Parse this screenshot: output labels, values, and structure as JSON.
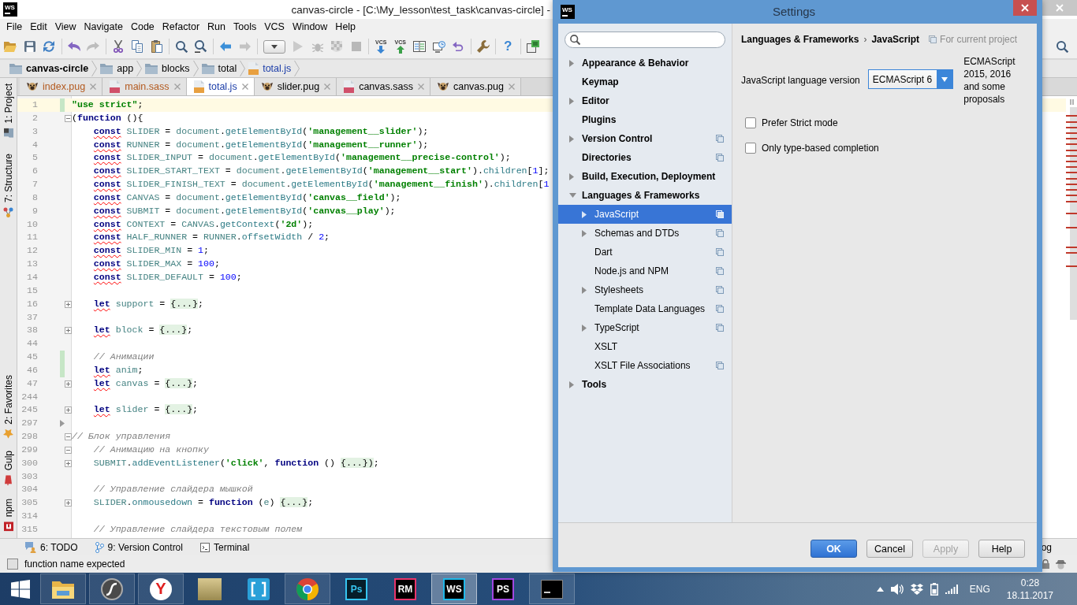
{
  "ide": {
    "logo": "WS",
    "title": "canvas-circle - [C:\\My_lesson\\test_task\\canvas-circle] -",
    "menu": [
      {
        "label": "File"
      },
      {
        "label": "Edit"
      },
      {
        "label": "View"
      },
      {
        "label": "Navigate"
      },
      {
        "label": "Code"
      },
      {
        "label": "Refactor"
      },
      {
        "label": "Run"
      },
      {
        "label": "Tools"
      },
      {
        "label": "VCS"
      },
      {
        "label": "Window"
      },
      {
        "label": "Help"
      }
    ],
    "toolbar": [
      {
        "kind": "open",
        "disabled": false
      },
      {
        "kind": "save",
        "disabled": false
      },
      {
        "kind": "sync",
        "disabled": false
      },
      {
        "kind": "separator"
      },
      {
        "kind": "undo",
        "disabled": false
      },
      {
        "kind": "redo",
        "disabled": true
      },
      {
        "kind": "separator"
      },
      {
        "kind": "cut",
        "disabled": false
      },
      {
        "kind": "copy",
        "disabled": false
      },
      {
        "kind": "paste",
        "disabled": false
      },
      {
        "kind": "separator"
      },
      {
        "kind": "find",
        "disabled": false
      },
      {
        "kind": "replace",
        "disabled": false
      },
      {
        "kind": "separator"
      },
      {
        "kind": "back",
        "disabled": false
      },
      {
        "kind": "forward",
        "disabled": true
      },
      {
        "kind": "separator"
      },
      {
        "kind": "run_config",
        "disabled": false
      },
      {
        "kind": "run",
        "disabled": true
      },
      {
        "kind": "debug",
        "disabled": true
      },
      {
        "kind": "coverage",
        "disabled": true
      },
      {
        "kind": "stop",
        "disabled": true
      },
      {
        "kind": "separator"
      },
      {
        "kind": "vcs_update",
        "label": "VCS",
        "disabled": false
      },
      {
        "kind": "vcs_commit",
        "label": "VCS",
        "disabled": false
      },
      {
        "kind": "compare",
        "disabled": false
      },
      {
        "kind": "history",
        "disabled": false
      },
      {
        "kind": "revert",
        "disabled": false
      },
      {
        "kind": "separator"
      },
      {
        "kind": "settings",
        "disabled": false
      },
      {
        "kind": "separator"
      },
      {
        "kind": "help",
        "text": "?",
        "disabled": false
      },
      {
        "kind": "separator"
      },
      {
        "kind": "module",
        "disabled": false
      },
      {
        "kind": "search_all",
        "disabled": false
      }
    ],
    "breadcrumbs": [
      {
        "label": "canvas-circle",
        "kind": "project"
      },
      {
        "label": "app",
        "kind": "folder"
      },
      {
        "label": "blocks",
        "kind": "folder"
      },
      {
        "label": "total",
        "kind": "folder"
      },
      {
        "label": "total.js",
        "kind": "js"
      }
    ],
    "tool_windows_top": [
      {
        "label": "1: Project",
        "kind": "project"
      },
      {
        "label": "7: Structure",
        "kind": "structure"
      }
    ],
    "tool_windows_bottom": [
      {
        "label": "2: Favorites",
        "kind": "favorites"
      },
      {
        "label": "Gulp",
        "kind": "gulp"
      },
      {
        "label": "npm",
        "kind": "npm"
      }
    ],
    "tabs": [
      {
        "label": "index.pug",
        "kind": "pug",
        "color": "#b35a1f",
        "selected": false
      },
      {
        "label": "main.sass",
        "kind": "sass",
        "color": "#b35a1f",
        "selected": false
      },
      {
        "label": "total.js",
        "kind": "js",
        "color": "#1a3ca8",
        "selected": true
      },
      {
        "label": "slider.pug",
        "kind": "pug",
        "color": "#000000",
        "selected": false
      },
      {
        "label": "canvas.sass",
        "kind": "sass",
        "color": "#000000",
        "selected": false
      },
      {
        "label": "canvas.pug",
        "kind": "pug",
        "color": "#000000",
        "selected": false
      }
    ],
    "editor": {
      "lines": [
        {
          "number": "1",
          "kind": "code",
          "text": "**\"use strict\"**;",
          "current": true,
          "changed": true
        },
        {
          "number": "2",
          "kind": "code",
          "text": "(**function** (){",
          "current": false,
          "changed": false,
          "folded": false,
          "warning": false,
          "children": [
            {
              "number": "3",
              "kind": "code",
              "text": "**const** SLIDER = document.getElementById(**'management__slider'**);",
              "current": false,
              "changed": false,
              "warning": true
            },
            {
              "number": "4",
              "kind": "code",
              "text": "**const** RUNNER = document.getElementById(**'management__runner'**);",
              "current": false,
              "changed": false,
              "warning": true
            },
            {
              "number": "5",
              "kind": "code",
              "text": "**const** SLIDER_INPUT = document.getElementById(**'management__precise-control'**);",
              "current": false,
              "changed": false,
              "warning": true
            },
            {
              "number": "6",
              "kind": "code",
              "text": "**const** SLIDER_START_TEXT = document.getElementById(**'management__start'**).children[1];",
              "current": false,
              "changed": false,
              "warning": true
            },
            {
              "number": "7",
              "kind": "code",
              "text": "**const** SLIDER_FINISH_TEXT = document.getElementById(**'management__finish'**).children[1",
              "current": false,
              "changed": false,
              "warning": true
            },
            {
              "number": "8",
              "kind": "code",
              "text": "**const** CANVAS = document.getElementById(**'canvas__field'**);",
              "current": false,
              "changed": false,
              "warning": true
            },
            {
              "number": "9",
              "kind": "code",
              "text": "**const** SUBMIT = document.getElementById(**'canvas__play'**);",
              "current": false,
              "changed": false,
              "warning": true
            },
            {
              "number": "10",
              "kind": "code",
              "text": "**const** CONTEXT = CANVAS.getContext(**'2d'**);",
              "current": false,
              "changed": false,
              "warning": true
            },
            {
              "number": "11",
              "kind": "code",
              "text": "**const** HALF_RUNNER = RUNNER.offsetWidth / 2;",
              "current": false,
              "changed": false,
              "warning": true
            },
            {
              "number": "12",
              "kind": "code",
              "text": "**const** SLIDER_MIN = 1;",
              "current": false,
              "changed": false,
              "warning": true
            },
            {
              "number": "13",
              "kind": "code",
              "text": "**const** SLIDER_MAX = 100;",
              "current": false,
              "changed": false,
              "warning": true
            },
            {
              "number": "14",
              "kind": "code",
              "text": "**const** SLIDER_DEFAULT = 100;",
              "current": false,
              "changed": false,
              "warning": true
            },
            {
              "number": "15",
              "current": false,
              "changed": false
            },
            {
              "number": "16",
              "kind": "code",
              "text": "**let** support = {...};",
              "current": false,
              "changed": false,
              "folded": true,
              "warning": true
            },
            {
              "number": "37",
              "current": false,
              "changed": false
            },
            {
              "number": "38",
              "kind": "code",
              "text": "**let** block = {...};",
              "current": false,
              "changed": false,
              "folded": true,
              "warning": true
            },
            {
              "number": "44",
              "current": false,
              "changed": false
            },
            {
              "number": "45",
              "kind": "comment",
              "text": "// Анимации",
              "current": false,
              "changed": true
            },
            {
              "number": "46",
              "kind": "code",
              "text": "**let** anim;",
              "current": false,
              "changed": true,
              "warning": true
            },
            {
              "number": "47",
              "kind": "code",
              "text": "**let** canvas = {...};",
              "current": false,
              "changed": false,
              "folded": true,
              "warning": true
            },
            {
              "number": "244",
              "current": false,
              "changed": false
            },
            {
              "number": "245",
              "kind": "code",
              "text": "**let** slider = {...};",
              "current": false,
              "changed": false,
              "folded": true,
              "warning": true
            },
            {
              "number": "297",
              "current": false,
              "changed": false,
              "arrow": true
            }
          ]
        },
        {
          "number": "298",
          "kind": "comment",
          "text": "// Блок управления",
          "current": false,
          "changed": false,
          "folded": false,
          "children": [
            {
              "number": "299",
              "kind": "comment",
              "text": "// Анимацию на кнопку",
              "current": false,
              "changed": false,
              "folded": false
            },
            {
              "number": "300",
              "kind": "code",
              "text": "SUBMIT.addEventListener(**'click'**, **function** () {...});",
              "current": false,
              "changed": false,
              "folded": true,
              "warning": false
            },
            {
              "number": "303",
              "current": false,
              "changed": false
            },
            {
              "number": "304",
              "kind": "comment",
              "text": "// Управление слайдера мышкой",
              "current": false,
              "changed": false
            },
            {
              "number": "305",
              "kind": "code",
              "text": "SLIDER.onmousedown = **function** (e) {...};",
              "current": false,
              "changed": false,
              "folded": true,
              "warning": false
            },
            {
              "number": "314",
              "current": false,
              "changed": false
            },
            {
              "number": "315",
              "kind": "comment",
              "text": "// Управление слайдера текстовым полем",
              "current": false,
              "changed": false
            }
          ]
        }
      ]
    },
    "tool_tabs": [
      {
        "label": "6: TODO",
        "kind": "todo"
      },
      {
        "label": "9: Version Control",
        "kind": "vcs"
      },
      {
        "label": "Terminal",
        "kind": "terminal"
      }
    ],
    "tool_tab_right": "og",
    "status": {
      "message": "function name expected"
    }
  },
  "settings": {
    "logo": "WS",
    "title": "Settings",
    "tree": [
      {
        "label": "Appearance & Behavior",
        "expanded": false,
        "project_scope": false,
        "selected": false
      },
      {
        "label": "Keymap",
        "project_scope": false,
        "selected": false
      },
      {
        "label": "Editor",
        "expanded": false,
        "project_scope": false,
        "selected": false
      },
      {
        "label": "Plugins",
        "project_scope": false,
        "selected": false
      },
      {
        "label": "Version Control",
        "expanded": false,
        "project_scope": true,
        "selected": false
      },
      {
        "label": "Directories",
        "project_scope": true,
        "selected": false
      },
      {
        "label": "Build, Execution, Deployment",
        "expanded": false,
        "project_scope": false,
        "selected": false
      },
      {
        "label": "Languages & Frameworks",
        "expanded": true,
        "project_scope": false,
        "selected": false,
        "children": [
          {
            "label": "JavaScript",
            "expanded": false,
            "project_scope": true,
            "selected": true
          },
          {
            "label": "Schemas and DTDs",
            "expanded": false,
            "project_scope": true,
            "selected": false
          },
          {
            "label": "Dart",
            "project_scope": true,
            "selected": false
          },
          {
            "label": "Node.js and NPM",
            "project_scope": true,
            "selected": false
          },
          {
            "label": "Stylesheets",
            "expanded": false,
            "project_scope": true,
            "selected": false
          },
          {
            "label": "Template Data Languages",
            "project_scope": true,
            "selected": false
          },
          {
            "label": "TypeScript",
            "expanded": false,
            "project_scope": true,
            "selected": false
          },
          {
            "label": "XSLT",
            "project_scope": false,
            "selected": false
          },
          {
            "label": "XSLT File Associations",
            "project_scope": true,
            "selected": false
          }
        ]
      },
      {
        "label": "Tools",
        "expanded": false,
        "project_scope": false,
        "selected": false
      }
    ],
    "path": [
      "Languages & Frameworks",
      "JavaScript"
    ],
    "path_separator": "›",
    "scope": "For current project",
    "language_version": {
      "label": "JavaScript language version",
      "value": "ECMAScript 6",
      "note": "ECMAScript 2015, 2016 and some proposals"
    },
    "options": [
      {
        "label": "Prefer Strict mode",
        "checked": false
      },
      {
        "label": "Only type-based completion",
        "checked": false
      }
    ],
    "buttons": [
      {
        "label": "OK",
        "default": true,
        "disabled": false
      },
      {
        "label": "Cancel",
        "default": false,
        "disabled": false
      },
      {
        "label": "Apply",
        "default": false,
        "disabled": true
      },
      {
        "label": "Help",
        "default": false,
        "disabled": false
      }
    ]
  },
  "taskbar": {
    "apps": [
      {
        "kind": "explorer",
        "running": true,
        "selected": false
      },
      {
        "kind": "flash",
        "running": true,
        "selected": false
      },
      {
        "kind": "yandex",
        "logo": "Y",
        "running": true,
        "selected": false
      },
      {
        "kind": "photo",
        "running": false,
        "selected": false
      },
      {
        "kind": "brackets",
        "running": false,
        "selected": false
      },
      {
        "kind": "chrome",
        "running": true,
        "selected": false
      },
      {
        "kind": "photoshop",
        "logo": "Ps",
        "running": false,
        "selected": false
      },
      {
        "kind": "rubymine",
        "logo": "RM",
        "running": false,
        "selected": false
      },
      {
        "kind": "webstorm",
        "logo": "WS",
        "running": true,
        "selected": true
      },
      {
        "kind": "phpstorm",
        "logo": "PS",
        "running": false,
        "selected": false
      },
      {
        "kind": "cmd",
        "running": true,
        "selected": false
      }
    ],
    "tray": {
      "language": "ENG",
      "time": "0:28",
      "date": "18.11.2017"
    }
  }
}
